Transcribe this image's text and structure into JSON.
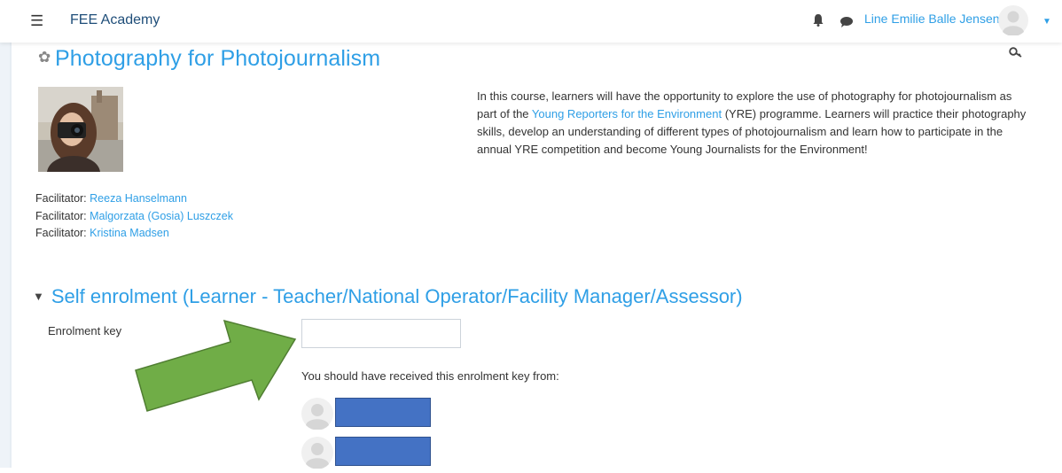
{
  "navbar": {
    "menu_icon": "hamburger-icon",
    "brand": "FEE Academy",
    "user_name": "Line Emilie Balle Jensen"
  },
  "course": {
    "title": "Photography for Photojournalism",
    "summary_before": "In this course, learners will have the opportunity to explore the use of photography for photojournalism as part of the ",
    "summary_link": "Young Reporters for the Environment",
    "summary_after": " (YRE) programme. Learners will practice their photography skills, develop an understanding of different types of photojournalism and learn how to participate in the annual YRE competition and become Young Journalists for the Environment!",
    "facilitator_label": "Facilitator:",
    "facilitators": [
      "Reeza Hanselmann",
      "Malgorzata (Gosia) Luszczek",
      "Kristina Madsen"
    ]
  },
  "enrolment": {
    "section_title": "Self enrolment (Learner - Teacher/National Operator/Facility Manager/Assessor)",
    "key_label": "Enrolment key",
    "key_value": "",
    "received_text": "You should have received this enrolment key from:"
  },
  "colors": {
    "link": "#2f9fe6",
    "brand": "#1f4e79",
    "arrow_fill": "#70ad47",
    "arrow_stroke": "#507e32",
    "redaction_box": "#4472c4"
  }
}
